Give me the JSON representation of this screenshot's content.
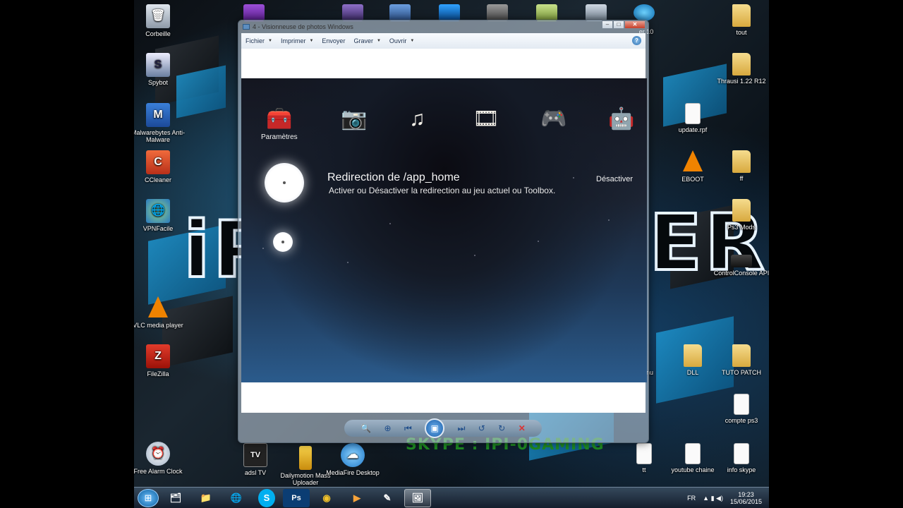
{
  "desktop": {
    "icons_left": [
      {
        "label": "Corbeille",
        "icon": "recycle-bin-icon",
        "glyph": "🗑"
      },
      {
        "label": "Spybot",
        "icon": "spybot-icon",
        "glyph": "S"
      },
      {
        "label": "Malwarebytes Anti-Malware",
        "icon": "malwarebytes-icon",
        "glyph": "M"
      },
      {
        "label": "CCleaner",
        "icon": "ccleaner-icon",
        "glyph": "C"
      },
      {
        "label": "VPNFacile",
        "icon": "vpn-icon",
        "glyph": "🌐"
      },
      {
        "label": "VLC media player",
        "icon": "vlc-icon",
        "glyph": ""
      },
      {
        "label": "FileZilla",
        "icon": "filezilla-icon",
        "glyph": "Z"
      },
      {
        "label": "Free Alarm Clock",
        "icon": "alarm-clock-icon",
        "glyph": "⏰"
      }
    ],
    "icons_right": [
      {
        "label": "tout",
        "icon": "folder-icon"
      },
      {
        "label": "Thrausi 1.22 R12",
        "icon": "folder-icon"
      },
      {
        "label": "ff",
        "icon": "folder-icon"
      },
      {
        "label": "Ps3 Mods",
        "icon": "folder-icon"
      },
      {
        "label": "ControlConsole API",
        "icon": "control-console-icon"
      },
      {
        "label": "TUTO PATCH",
        "icon": "folder-icon"
      },
      {
        "label": "compte ps3",
        "icon": "file-icon"
      },
      {
        "label": "info skype",
        "icon": "file-icon"
      }
    ],
    "icons_mid": [
      {
        "label": "update.rpf",
        "icon": "file-icon"
      },
      {
        "label": "EBOOT",
        "icon": "vlc-icon"
      },
      {
        "label": "DLL",
        "icon": "folder-icon"
      },
      {
        "label": "youtube chaine",
        "icon": "file-icon"
      },
      {
        "label": "tt",
        "icon": "file-icon"
      }
    ],
    "icons_bottom": [
      {
        "label": "adsl TV",
        "icon": "adsl-tv-icon",
        "glyph": "TV"
      },
      {
        "label": "Dailymotion Mass Uploader",
        "icon": "dailymotion-icon",
        "glyph": "▮"
      },
      {
        "label": "MediaFire Desktop",
        "icon": "mediafire-icon",
        "glyph": "☁"
      }
    ],
    "partial_labels": {
      "er10": "er 10",
      "nu": "nu"
    },
    "wallpaper_text_left": "iP",
    "wallpaper_text_right": "ER",
    "skype_text": "SKYPE : IPI-0GAMING"
  },
  "viewer": {
    "title": "4 - Visionneuse de photos Windows",
    "menu": [
      {
        "label": "Fichier",
        "dropdown": true
      },
      {
        "label": "Imprimer",
        "dropdown": true
      },
      {
        "label": "Envoyer",
        "dropdown": false
      },
      {
        "label": "Graver",
        "dropdown": true
      },
      {
        "label": "Ouvrir",
        "dropdown": true
      }
    ],
    "help_label": "?",
    "controls": {
      "minimize": "–",
      "maximize": "□",
      "close": "✕"
    }
  },
  "ps3": {
    "xmb": [
      {
        "icon": "toolbox-icon",
        "glyph": "🧰",
        "label": "Paramètres",
        "selected": true
      },
      {
        "icon": "camera-icon",
        "glyph": "📷",
        "label": "",
        "selected": false
      },
      {
        "icon": "music-icon",
        "glyph": "♫",
        "label": "",
        "selected": false
      },
      {
        "icon": "film-icon",
        "glyph": "🎞",
        "label": "",
        "selected": false
      },
      {
        "icon": "gamepad-icon",
        "glyph": "🎮",
        "label": "",
        "selected": false
      },
      {
        "icon": "robot-icon",
        "glyph": "🤖",
        "label": "",
        "selected": false
      }
    ],
    "option": {
      "title": "Redirection de /app_home",
      "description": "Activer ou Désactiver la redirection au jeu actuel ou Toolbox.",
      "value": "Désactiver"
    }
  },
  "taskbar": {
    "apps": [
      {
        "icon": "explorer-icon",
        "glyph": "🗂"
      },
      {
        "icon": "folder-icon",
        "glyph": "📁"
      },
      {
        "icon": "vpn-icon",
        "glyph": "🌐"
      },
      {
        "icon": "skype-icon",
        "glyph": "S"
      },
      {
        "icon": "photoshop-icon",
        "glyph": "Ps"
      },
      {
        "icon": "chrome-icon",
        "glyph": "◉"
      },
      {
        "icon": "media-player-icon",
        "glyph": "▶"
      },
      {
        "icon": "notepad-icon",
        "glyph": "✎"
      },
      {
        "icon": "photo-viewer-icon",
        "glyph": "🖼"
      }
    ],
    "lang": "FR",
    "time": "19:23",
    "date": "15/06/2015"
  }
}
